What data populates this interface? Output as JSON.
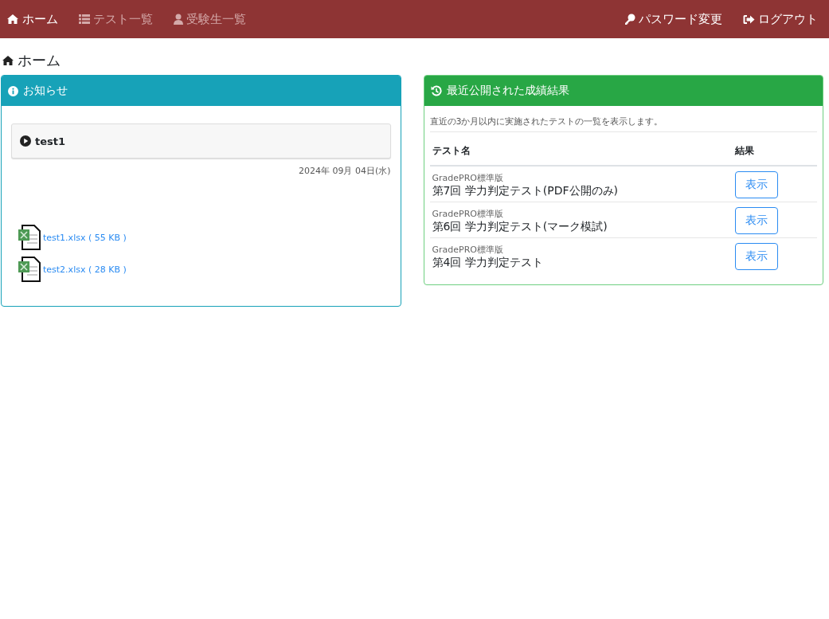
{
  "navbar": {
    "left": [
      {
        "label": "ホーム",
        "kind": "home",
        "selected": true
      },
      {
        "label": "テスト一覧",
        "kind": "list",
        "selected": false
      },
      {
        "label": "受験生一覧",
        "kind": "user",
        "selected": false
      }
    ],
    "right": [
      {
        "label": "パスワード変更",
        "kind": "key"
      },
      {
        "label": "ログアウト",
        "kind": "logout"
      }
    ]
  },
  "page_title": "ホーム",
  "notice_card": {
    "title": "お知らせ",
    "notice_title": "test1",
    "date": "2024年 09月 04日(水)",
    "attachments": [
      "test1.xlsx ( 55 KB )",
      "test2.xlsx ( 28 KB )"
    ]
  },
  "results_card": {
    "title": "最近公開された成績結果",
    "description": "直近の3か月以内に実施されたテストの一覧を表示します。",
    "columns": [
      "テスト名",
      "結果"
    ],
    "rows": [
      {
        "edition": "GradePRO標準版",
        "name": "第7回 学力判定テスト(PDF公開のみ)",
        "button": "表示"
      },
      {
        "edition": "GradePRO標準版",
        "name": "第6回 学力判定テスト(マーク模試)",
        "button": "表示"
      },
      {
        "edition": "GradePRO標準版",
        "name": "第4回 学力判定テスト",
        "button": "表示"
      }
    ]
  }
}
